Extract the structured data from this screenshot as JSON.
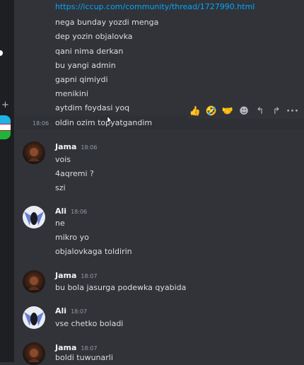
{
  "colors": {
    "background": "#313338",
    "link": "#00a8fc",
    "text": "#dbdee1",
    "muted": "#949ba4",
    "hover": "#2e3035"
  },
  "server_rail": {
    "add_icon": "+",
    "flag": "uzbekistan-flag"
  },
  "continued_messages": {
    "link": "https://iccup.com/community/thread/1727990.html",
    "lines": [
      "nega bunday yozdi menga",
      "dep yozin objalovka",
      "qani nima derkan",
      "bu yangi admin",
      "gapni qimiydi",
      "menikini",
      "aytdim foydasi yoq",
      "oldin ozim topyatgandim"
    ],
    "hover_timestamp": "18:06"
  },
  "toolbar": {
    "reactions": [
      "👍",
      "🤣",
      "🤝"
    ],
    "icons": [
      "add-reaction-icon",
      "reply-icon",
      "forward-icon",
      "more-icon"
    ],
    "add_reaction": "☻",
    "reply": "↰",
    "forward": "↱",
    "more": "···"
  },
  "messages": [
    {
      "author": "Jama",
      "time": "18:06",
      "lines": [
        "vois",
        "4aqremi ?",
        "szi"
      ]
    },
    {
      "author": "Ali",
      "time": "18:06",
      "lines": [
        "ne",
        "mikro yo",
        "objalovkaga toldirin"
      ]
    },
    {
      "author": "Jama",
      "time": "18:07",
      "lines": [
        "bu bola jasurga podewka qyabida"
      ]
    },
    {
      "author": "Ali",
      "time": "18:07",
      "lines": [
        "vse chetko boladi"
      ]
    },
    {
      "author": "Jama",
      "time": "18:07",
      "lines": [
        "boldi tuwunarli"
      ]
    }
  ]
}
